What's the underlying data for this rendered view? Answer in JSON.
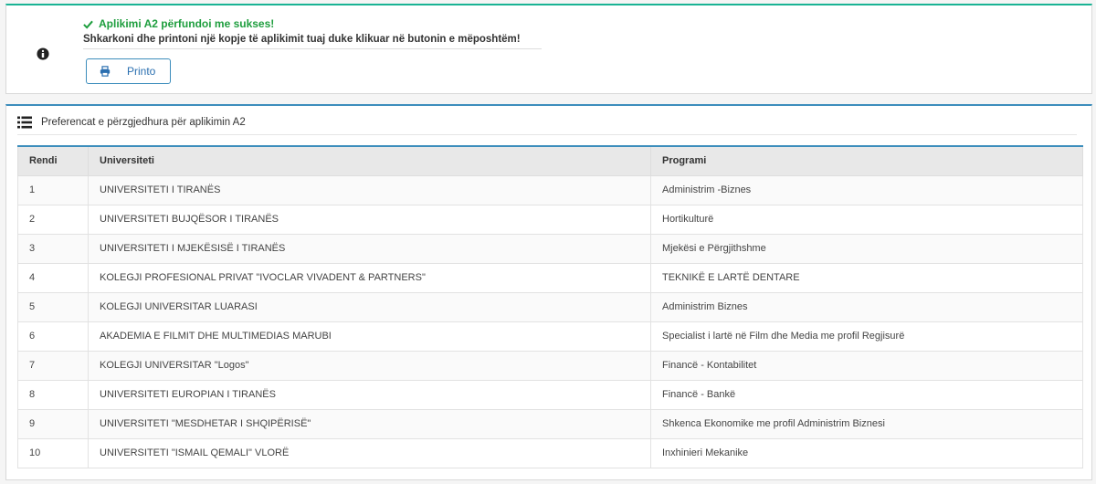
{
  "alert": {
    "success_message": "Aplikimi A2 përfundoi me sukses!",
    "instruction": "Shkarkoni dhe printoni një kopje të aplikimit tuaj duke klikuar në butonin e mëposhtëm!",
    "print_button_label": "Printo",
    "accent_color": "#1ab394"
  },
  "preferences": {
    "title": "Preferencat e përzgjedhura për aplikimin A2",
    "columns": {
      "rendi": "Rendi",
      "universiteti": "Universiteti",
      "programi": "Programi"
    },
    "rows": [
      {
        "rendi": "1",
        "universiteti": "UNIVERSITETI I TIRANËS",
        "programi": "Administrim -Biznes"
      },
      {
        "rendi": "2",
        "universiteti": "UNIVERSITETI BUJQËSOR I TIRANËS",
        "programi": "Hortikulturë"
      },
      {
        "rendi": "3",
        "universiteti": "UNIVERSITETI I MJEKËSISË I TIRANËS",
        "programi": "Mjekësi e Përgjithshme"
      },
      {
        "rendi": "4",
        "universiteti": "KOLEGJI PROFESIONAL PRIVAT \"IVOCLAR VIVADENT & PARTNERS\"",
        "programi": "TEKNIKË E LARTË DENTARE"
      },
      {
        "rendi": "5",
        "universiteti": "KOLEGJI UNIVERSITAR LUARASI",
        "programi": "Administrim Biznes"
      },
      {
        "rendi": "6",
        "universiteti": "AKADEMIA E FILMIT DHE MULTIMEDIAS MARUBI",
        "programi": "Specialist i lartë në Film dhe Media me profil Regjisurë"
      },
      {
        "rendi": "7",
        "universiteti": "KOLEGJI UNIVERSITAR \"Logos\"",
        "programi": "Financë - Kontabilitet"
      },
      {
        "rendi": "8",
        "universiteti": "UNIVERSITETI EUROPIAN I TIRANËS",
        "programi": "Financë - Bankë"
      },
      {
        "rendi": "9",
        "universiteti": "UNIVERSITETI \"MESDHETAR I SHQIPËRISË\"",
        "programi": "Shkenca Ekonomike me profil Administrim Biznesi"
      },
      {
        "rendi": "10",
        "universiteti": "UNIVERSITETI \"ISMAIL QEMALI\" VLORË",
        "programi": "Inxhinieri Mekanike"
      }
    ],
    "accent_color": "#3c8dbc"
  },
  "icons": {
    "info": "info-circle-icon",
    "check": "check-icon",
    "print": "print-icon",
    "list": "list-icon"
  }
}
